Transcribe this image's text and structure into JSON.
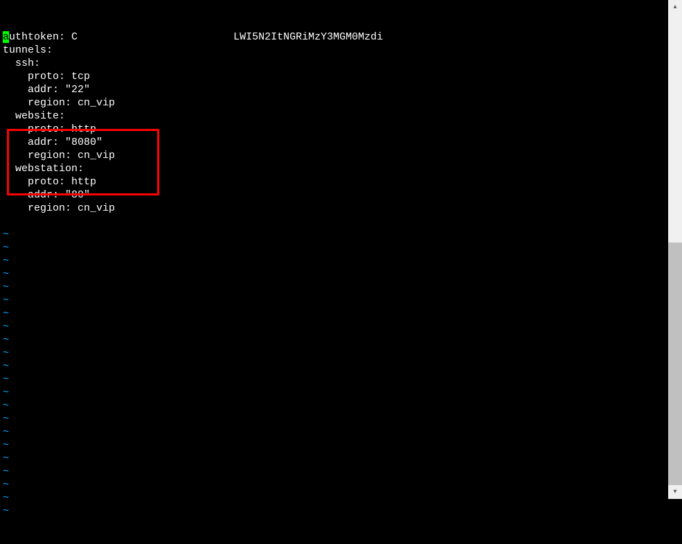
{
  "terminal": {
    "lines": [
      {
        "type": "cursor-start",
        "cursor": "a",
        "rest": "uthtoken: ",
        "visible_token_start": "C",
        "redacted": "█████████████████████████",
        "visible_token_end": "LWI5N2ItNGRiMzY3MGM0Mzdi"
      },
      {
        "type": "text",
        "content": "tunnels:"
      },
      {
        "type": "text",
        "content": "  ssh:"
      },
      {
        "type": "text",
        "content": "    proto: tcp"
      },
      {
        "type": "text",
        "content": "    addr: \"22\""
      },
      {
        "type": "text",
        "content": "    region: cn_vip"
      },
      {
        "type": "text",
        "content": "  website:"
      },
      {
        "type": "text",
        "content": "    proto: http"
      },
      {
        "type": "text",
        "content": "    addr: \"8080\""
      },
      {
        "type": "text",
        "content": "    region: cn_vip"
      },
      {
        "type": "text",
        "content": "  webstation:"
      },
      {
        "type": "text",
        "content": "    proto: http"
      },
      {
        "type": "text",
        "content": "    addr: \"80\""
      },
      {
        "type": "text",
        "content": "    region: cn_vip"
      },
      {
        "type": "text",
        "content": ""
      },
      {
        "type": "tilde",
        "content": "~"
      },
      {
        "type": "tilde",
        "content": "~"
      },
      {
        "type": "tilde",
        "content": "~"
      },
      {
        "type": "tilde",
        "content": "~"
      },
      {
        "type": "tilde",
        "content": "~"
      },
      {
        "type": "tilde",
        "content": "~"
      },
      {
        "type": "tilde",
        "content": "~"
      },
      {
        "type": "tilde",
        "content": "~"
      },
      {
        "type": "tilde",
        "content": "~"
      },
      {
        "type": "tilde",
        "content": "~"
      },
      {
        "type": "tilde",
        "content": "~"
      },
      {
        "type": "tilde",
        "content": "~"
      },
      {
        "type": "tilde",
        "content": "~"
      },
      {
        "type": "tilde",
        "content": "~"
      },
      {
        "type": "tilde",
        "content": "~"
      },
      {
        "type": "tilde",
        "content": "~"
      },
      {
        "type": "tilde",
        "content": "~"
      },
      {
        "type": "tilde",
        "content": "~"
      },
      {
        "type": "tilde",
        "content": "~"
      },
      {
        "type": "tilde",
        "content": "~"
      },
      {
        "type": "tilde",
        "content": "~"
      },
      {
        "type": "tilde",
        "content": "~"
      }
    ]
  },
  "annotation": {
    "highlight_color": "#ff0000"
  },
  "scrollbar": {
    "up_arrow": "▴",
    "down_arrow": "▾"
  }
}
